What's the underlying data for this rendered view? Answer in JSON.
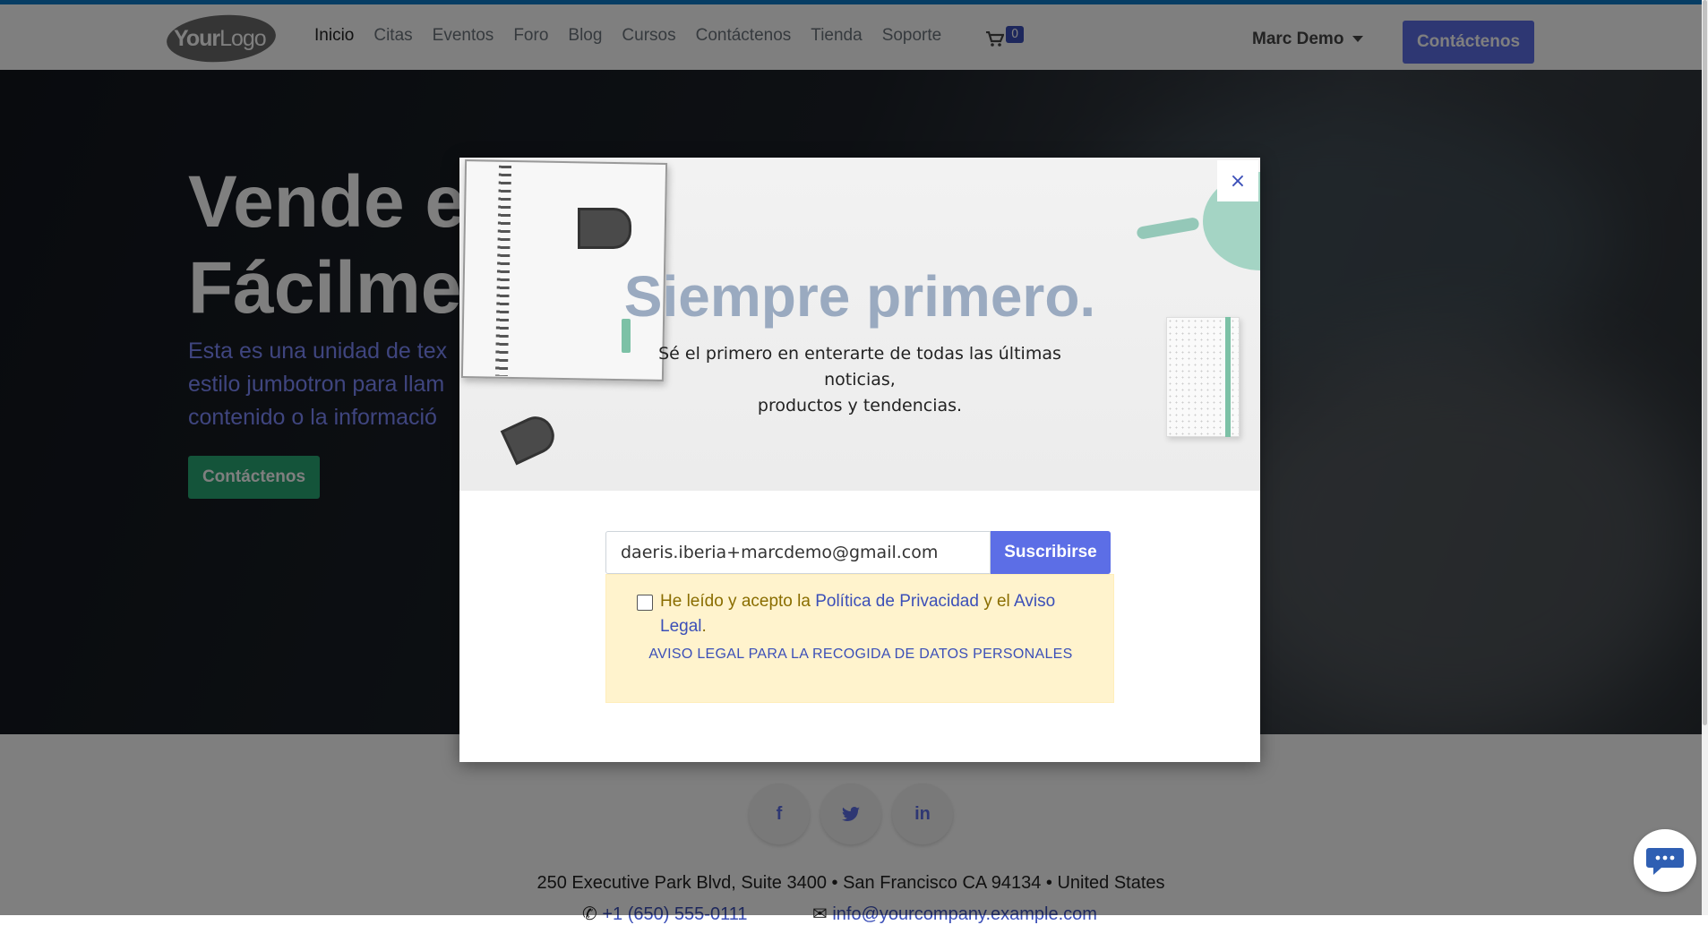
{
  "navbar": {
    "logo_text_bold": "Your",
    "logo_text_light": "Logo",
    "menu": [
      {
        "label": "Inicio",
        "active": true
      },
      {
        "label": "Citas"
      },
      {
        "label": "Eventos"
      },
      {
        "label": "Foro"
      },
      {
        "label": "Blog"
      },
      {
        "label": "Cursos"
      },
      {
        "label": "Contáctenos"
      },
      {
        "label": "Tienda"
      },
      {
        "label": "Soporte"
      }
    ],
    "cart_icon": "shopping-cart-icon",
    "cart_count": "0",
    "user_name": "Marc Demo",
    "cta_label": "Contáctenos",
    "accent_color": "#5c6ee6"
  },
  "hero": {
    "title_line1": "Vende e",
    "title_line2": "Fácilme",
    "text_line1": "Esta es una unidad de tex",
    "text_line2": "estilo jumbotron para llam",
    "text_line3": "contenido o la informació",
    "button_label": "Contáctenos",
    "button_color": "#28a875"
  },
  "footer": {
    "social": [
      {
        "icon": "facebook-icon",
        "glyph": "f"
      },
      {
        "icon": "twitter-icon",
        "glyph": "t"
      },
      {
        "icon": "linkedin-icon",
        "glyph": "in"
      }
    ],
    "address": "250 Executive Park Blvd, Suite 3400 • San Francisco CA 94134 • United States",
    "phone": "+1 (650) 555-0111",
    "email": "info@yourcompany.example.com"
  },
  "modal": {
    "close_label": "×",
    "heading": "Siempre primero.",
    "subtitle_line1": "Sé el primero en enterarte de todas las últimas noticias,",
    "subtitle_line2": "productos y tendencias.",
    "email_value": "daeris.iberia+marcdemo@gmail.com",
    "subscribe_label": "Suscribirse",
    "consent_prefix": "He leído y acepto la ",
    "privacy_link": "Política de Privacidad",
    "consent_and": " y el ",
    "legal_link": "Aviso Legal",
    "consent_suffix": ".",
    "legal_notice_link": "AVISO LEGAL PARA LA RECOGIDA DE DATOS PERSONALES"
  },
  "chat": {
    "icon": "chat-bubble-icon"
  }
}
